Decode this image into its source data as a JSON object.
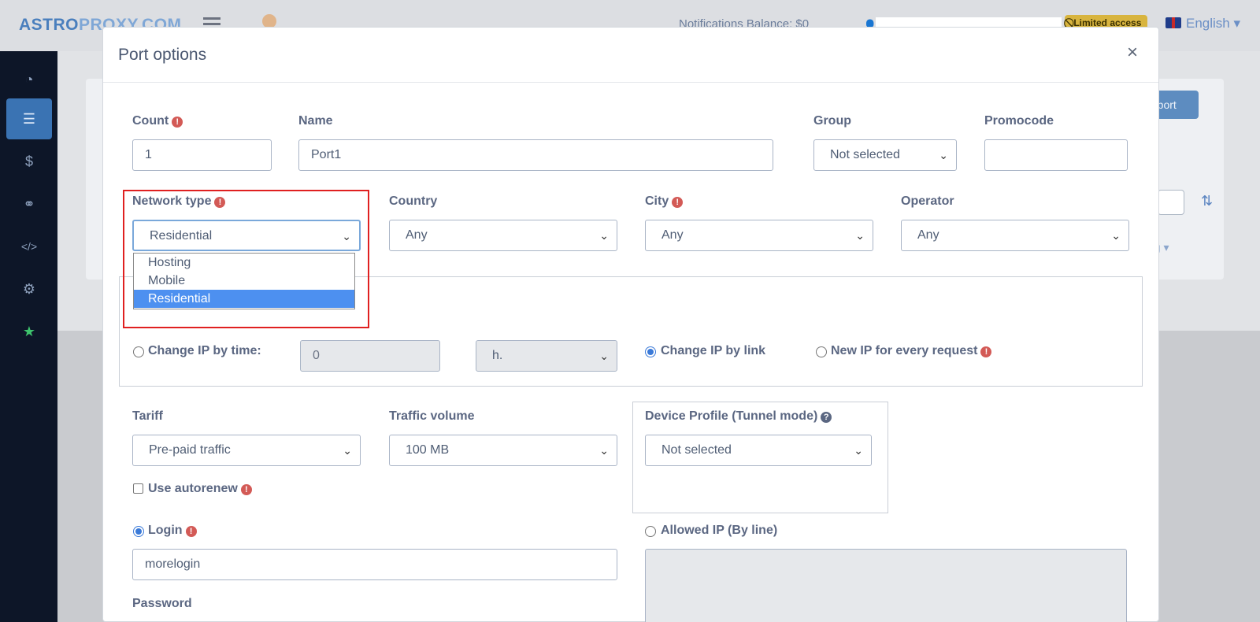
{
  "topbar": {
    "logo_main": "ASTRO",
    "logo_accent": "PROXY.COM",
    "info": "Notifications   Balance: $0",
    "limited_label": "Limited access",
    "language": "English"
  },
  "sidebar": {
    "items": [
      {
        "icon": "dashboard-icon",
        "glyph": "◔"
      },
      {
        "icon": "ports-icon",
        "glyph": "☰"
      },
      {
        "icon": "dollar-icon",
        "glyph": "$"
      },
      {
        "icon": "handshake-icon",
        "glyph": "⚭"
      },
      {
        "icon": "code-icon",
        "glyph": "</>"
      },
      {
        "icon": "gears-icon",
        "glyph": "⚙"
      },
      {
        "icon": "star-icon",
        "glyph": "★"
      }
    ]
  },
  "background": {
    "add_port_label": "d port",
    "link_label": "ng ▾"
  },
  "modal": {
    "title": "Port options",
    "close": "×",
    "count": {
      "label": "Count",
      "value": "1"
    },
    "name": {
      "label": "Name",
      "value": "Port1"
    },
    "group": {
      "label": "Group",
      "value": "Not selected"
    },
    "promocode": {
      "label": "Promocode",
      "value": ""
    },
    "network_type": {
      "label": "Network type",
      "value": "Residential",
      "options": [
        "Hosting",
        "Mobile",
        "Residential"
      ]
    },
    "country": {
      "label": "Country",
      "value": "Any"
    },
    "city": {
      "label": "City",
      "value": "Any"
    },
    "operator": {
      "label": "Operator",
      "value": "Any"
    },
    "ip_change": {
      "by_time_label": "Change IP by time:",
      "time_value": "0",
      "time_unit": "h.",
      "by_link_label": "Change IP by link",
      "every_request_label": "New IP for every request",
      "selected": "by_link"
    },
    "tariff": {
      "label": "Tariff",
      "value": "Pre-paid traffic"
    },
    "traffic_volume": {
      "label": "Traffic volume",
      "value": "100 MB"
    },
    "device_profile": {
      "label": "Device Profile (Tunnel mode)",
      "value": "Not selected"
    },
    "autorenew_label": "Use autorenew",
    "login": {
      "label": "Login",
      "value": "morelogin"
    },
    "allowed_ip_label": "Allowed IP (By line)",
    "password_label": "Password"
  }
}
